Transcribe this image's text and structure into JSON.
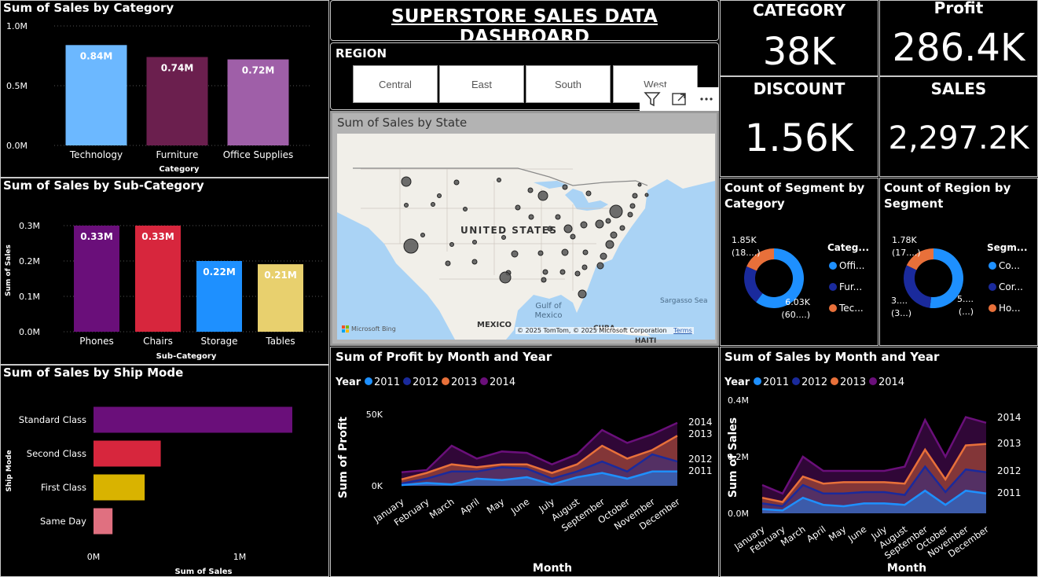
{
  "dashboard_title": "SUPERSTORE SALES DATA DASHBOARD",
  "region_slicer": {
    "title": "REGION",
    "options": [
      "Central",
      "East",
      "South",
      "West"
    ]
  },
  "kpis": {
    "category": {
      "label": "CATEGORY",
      "value": "38K"
    },
    "profit": {
      "label": "Profit",
      "value": "286.4K"
    },
    "discount": {
      "label": "DISCOUNT",
      "value": "1.56K"
    },
    "sales": {
      "label": "SALES",
      "value": "2,297.2K"
    }
  },
  "map": {
    "title": "Sum of Sales by State",
    "labels": {
      "country": "UNITED STATES",
      "gulf": "Gulf of Mexico",
      "sargasso": "Sargasso Sea",
      "mexico": "MEXICO",
      "cuba": "CUBA",
      "haiti": "HAITI"
    },
    "attribution": "© 2025 TomTom, © 2025 Microsoft Corporation",
    "terms": "Terms",
    "bing": "Microsoft Bing"
  },
  "visual_header_icons": [
    "filter-icon",
    "focus-mode-icon",
    "more-options-icon"
  ],
  "chart_data": [
    {
      "id": "sales_by_category",
      "type": "bar",
      "title": "Sum of Sales by Category",
      "xlabel": "Category",
      "categories": [
        "Technology",
        "Furniture",
        "Office Supplies"
      ],
      "values": [
        0.84,
        0.74,
        0.72
      ],
      "data_labels": [
        "0.84M",
        "0.74M",
        "0.72M"
      ],
      "colors": [
        "#6cb8ff",
        "#6b1f4e",
        "#9f5fa8"
      ],
      "yticks": [
        "0.0M",
        "0.5M",
        "1.0M"
      ],
      "ylim": [
        0,
        1.0
      ]
    },
    {
      "id": "sales_by_subcategory",
      "type": "bar",
      "title": "Sum of Sales by Sub-Category",
      "xlabel": "Sub-Category",
      "ylabel": "Sum of Sales",
      "categories": [
        "Phones",
        "Chairs",
        "Storage",
        "Tables"
      ],
      "values": [
        0.33,
        0.33,
        0.22,
        0.21
      ],
      "data_labels": [
        "0.33M",
        "0.33M",
        "0.22M",
        "0.21M"
      ],
      "colors": [
        "#6a0f7a",
        "#d7263d",
        "#1e90ff",
        "#e8d06e"
      ],
      "yticks": [
        "0.0M",
        "0.1M",
        "0.2M",
        "0.3M"
      ],
      "ylim": [
        0,
        0.33
      ]
    },
    {
      "id": "sales_by_shipmode",
      "type": "bar",
      "orientation": "horizontal",
      "title": "Sum of Sales by Ship Mode",
      "xlabel": "Sum of Sales",
      "ylabel": "Ship Mode",
      "categories": [
        "Standard Class",
        "Second Class",
        "First Class",
        "Same Day"
      ],
      "values": [
        1.36,
        0.46,
        0.35,
        0.13
      ],
      "colors": [
        "#6a0f7a",
        "#d7263d",
        "#d9b300",
        "#e07080"
      ],
      "xticks": [
        "0M",
        "1M"
      ],
      "xlim": [
        0,
        1.36
      ]
    },
    {
      "id": "segment_by_category",
      "type": "pie",
      "donut": true,
      "title": "Count of Segment by Category",
      "legend_title": "Categ...",
      "legend": [
        "Offi...",
        "Fur...",
        "Tec..."
      ],
      "colors": [
        "#1e90ff",
        "#1a2a9c",
        "#e8703a"
      ],
      "values": [
        6.03,
        2.12,
        1.85
      ],
      "labels": [
        {
          "value": "6.03K",
          "pct": "(60....)"
        },
        {
          "value": "1.85K",
          "pct": "(18....)"
        }
      ]
    },
    {
      "id": "region_by_segment",
      "type": "pie",
      "donut": true,
      "title": "Count of Region by Segment",
      "legend_title": "Segm...",
      "legend": [
        "Co...",
        "Cor...",
        "Ho..."
      ],
      "colors": [
        "#1e90ff",
        "#1a2a9c",
        "#e8703a"
      ],
      "values": [
        5.19,
        3.02,
        1.78
      ],
      "labels": [
        {
          "value": "5....",
          "pct": "(...)"
        },
        {
          "value": "3....",
          "pct": "(3...)"
        },
        {
          "value": "1.78K",
          "pct": "(17....)"
        }
      ]
    },
    {
      "id": "profit_by_month_year",
      "type": "area",
      "stacked": true,
      "title": "Sum of Profit by Month and Year",
      "legend_title": "Year",
      "xlabel": "Month",
      "ylabel": "Sum of Profit",
      "yticks": [
        "0K",
        "50K"
      ],
      "ylim": [
        0,
        50
      ],
      "x": [
        "January",
        "February",
        "March",
        "April",
        "May",
        "June",
        "July",
        "August",
        "September",
        "October",
        "November",
        "December"
      ],
      "series": [
        {
          "name": "2011",
          "color": "#1e90ff",
          "values": [
            0.5,
            2,
            1,
            5,
            4,
            6,
            1,
            6,
            9,
            5,
            10,
            10
          ]
        },
        {
          "name": "2012",
          "color": "#1a2a9c",
          "values": [
            1,
            3,
            9,
            5,
            9,
            6,
            4,
            4,
            8,
            5,
            12,
            7
          ]
        },
        {
          "name": "2013",
          "color": "#e8703a",
          "values": [
            3,
            4,
            5,
            3,
            2,
            3,
            4,
            5,
            11,
            9,
            3,
            18
          ]
        },
        {
          "name": "2014",
          "color": "#6a0f7a",
          "values": [
            5,
            2,
            13,
            6,
            9,
            8,
            6,
            7,
            11,
            11,
            11,
            9
          ]
        }
      ],
      "end_labels": [
        "2014",
        "2013",
        "2012",
        "2011"
      ]
    },
    {
      "id": "sales_by_month_year",
      "type": "area",
      "stacked": true,
      "title": "Sum of Sales by Month and Year",
      "legend_title": "Year",
      "xlabel": "Month",
      "ylabel": "Sum of Sales",
      "yticks": [
        "0.0M",
        "0.2M",
        "0.4M"
      ],
      "ylim": [
        0,
        0.4
      ],
      "x": [
        "January",
        "February",
        "March",
        "April",
        "May",
        "June",
        "July",
        "August",
        "September",
        "October",
        "November",
        "December"
      ],
      "series": [
        {
          "name": "2011",
          "color": "#1e90ff",
          "values": [
            0.015,
            0.01,
            0.055,
            0.03,
            0.025,
            0.035,
            0.035,
            0.03,
            0.08,
            0.03,
            0.08,
            0.07
          ]
        },
        {
          "name": "2012",
          "color": "#1a2a9c",
          "values": [
            0.02,
            0.015,
            0.045,
            0.04,
            0.045,
            0.04,
            0.04,
            0.035,
            0.085,
            0.045,
            0.075,
            0.075
          ]
        },
        {
          "name": "2013",
          "color": "#e8703a",
          "values": [
            0.02,
            0.015,
            0.03,
            0.035,
            0.04,
            0.035,
            0.035,
            0.04,
            0.06,
            0.045,
            0.085,
            0.1
          ]
        },
        {
          "name": "2014",
          "color": "#6a0f7a",
          "values": [
            0.045,
            0.03,
            0.07,
            0.045,
            0.04,
            0.04,
            0.04,
            0.06,
            0.105,
            0.08,
            0.1,
            0.075
          ]
        }
      ],
      "end_labels": [
        "2014",
        "2013",
        "2012",
        "2011"
      ]
    }
  ]
}
